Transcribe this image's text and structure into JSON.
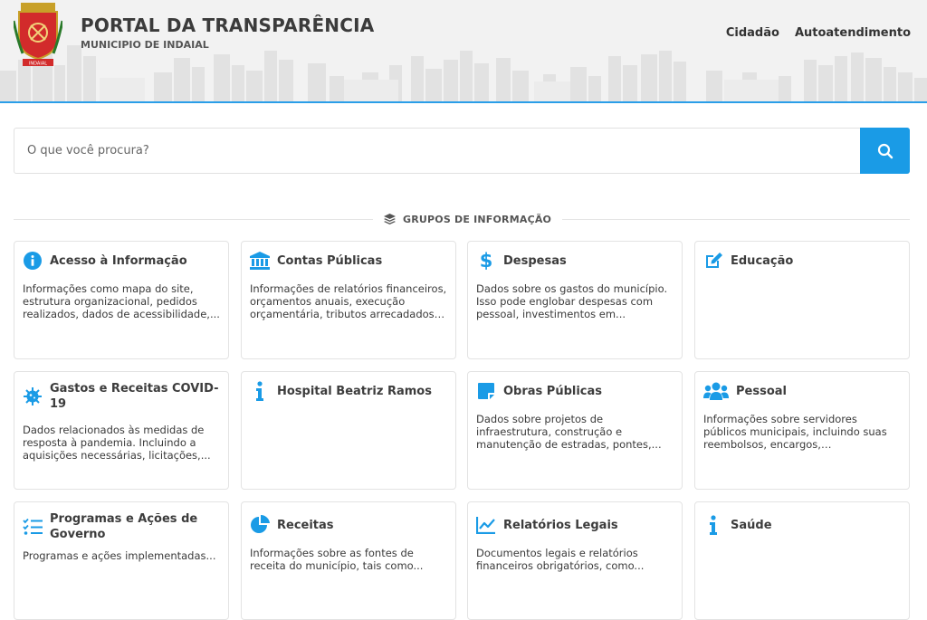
{
  "header": {
    "title": "PORTAL DA TRANSPARÊNCIA",
    "subtitle": "MUNICIPIO DE INDAIAL",
    "logo_ribbon": "INDAIAL",
    "nav": [
      "Cidadão",
      "Autoatendimento"
    ]
  },
  "search": {
    "placeholder": "O que você procura?",
    "icon": "search-icon"
  },
  "section": {
    "title": "GRUPOS DE INFORMAÇÃO",
    "icon": "layers-icon"
  },
  "colors": {
    "accent": "#1a9be6",
    "header_bg": "#f2f2f2"
  },
  "cards": [
    {
      "title": "Acesso à Informação",
      "icon": "info-circle-icon",
      "desc": "Informações como mapa do site, estrutura organizacional, pedidos realizados, dados de acessibilidade,..."
    },
    {
      "title": "Contas Públicas",
      "icon": "bank-icon",
      "desc": "Informações de relatórios financeiros, orçamentos anuais, execução orçamentária, tributos arrecadados e..."
    },
    {
      "title": "Despesas",
      "icon": "dollar-icon",
      "desc": "Dados sobre os gastos do município. Isso pode englobar despesas com pessoal, investimentos em..."
    },
    {
      "title": "Educação",
      "icon": "edit-icon",
      "desc": ""
    },
    {
      "title": "Gastos e Receitas COVID-19",
      "icon": "virus-icon",
      "desc": "Dados relacionados às medidas de resposta à pandemia. Incluindo a aquisições necessárias, licitações,..."
    },
    {
      "title": "Hospital Beatriz Ramos",
      "icon": "info-icon",
      "desc": ""
    },
    {
      "title": "Obras Públicas",
      "icon": "sticky-note-icon",
      "desc": "Dados sobre projetos de infraestrutura, construção e manutenção de estradas, pontes,..."
    },
    {
      "title": "Pessoal",
      "icon": "users-icon",
      "desc": "Informações sobre servidores públicos municipais, incluindo suas reembolsos, encargos, remuneração,..."
    },
    {
      "title": "Programas e Ações de Governo",
      "icon": "tasks-icon",
      "desc": "Programas e ações implementadas..."
    },
    {
      "title": "Receitas",
      "icon": "pie-chart-icon",
      "desc": "Informações sobre as fontes de receita do município, tais como..."
    },
    {
      "title": "Relatórios Legais",
      "icon": "line-chart-icon",
      "desc": "Documentos legais e relatórios financeiros obrigatórios, como..."
    },
    {
      "title": "Saúde",
      "icon": "info-icon",
      "desc": ""
    }
  ]
}
